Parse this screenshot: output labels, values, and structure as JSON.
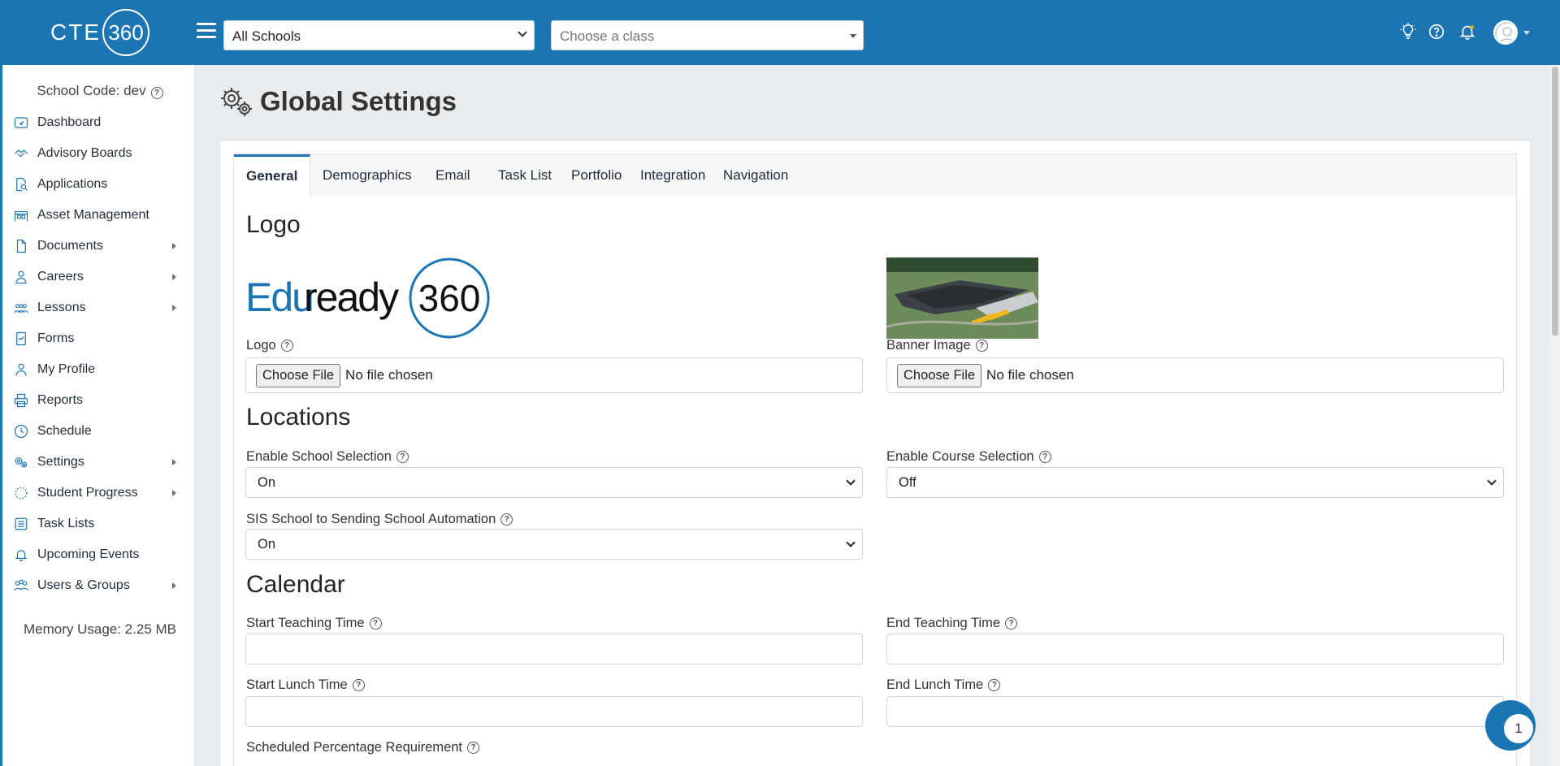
{
  "header": {
    "brand_text": "CTE",
    "brand_ring": "360",
    "school_select": "All Schools",
    "class_select_placeholder": "Choose a class",
    "icons": [
      "lightbulb-icon",
      "help-icon",
      "bell-icon",
      "user-avatar"
    ]
  },
  "sidebar": {
    "school_code": "School Code: dev",
    "items": [
      {
        "label": "Dashboard",
        "icon": "dashboard-icon",
        "has_submenu": false
      },
      {
        "label": "Advisory Boards",
        "icon": "handshake-icon",
        "has_submenu": false
      },
      {
        "label": "Applications",
        "icon": "document-search-icon",
        "has_submenu": false
      },
      {
        "label": "Asset Management",
        "icon": "warehouse-icon",
        "has_submenu": false
      },
      {
        "label": "Documents",
        "icon": "file-icon",
        "has_submenu": true
      },
      {
        "label": "Careers",
        "icon": "careers-icon",
        "has_submenu": true
      },
      {
        "label": "Lessons",
        "icon": "people-icon",
        "has_submenu": true
      },
      {
        "label": "Forms",
        "icon": "form-icon",
        "has_submenu": false
      },
      {
        "label": "My Profile",
        "icon": "user-icon",
        "has_submenu": false
      },
      {
        "label": "Reports",
        "icon": "printer-icon",
        "has_submenu": false
      },
      {
        "label": "Schedule",
        "icon": "clock-icon",
        "has_submenu": false
      },
      {
        "label": "Settings",
        "icon": "gears-icon",
        "has_submenu": true
      },
      {
        "label": "Student Progress",
        "icon": "progress-icon",
        "has_submenu": true
      },
      {
        "label": "Task Lists",
        "icon": "list-icon",
        "has_submenu": false
      },
      {
        "label": "Upcoming Events",
        "icon": "bell-icon",
        "has_submenu": false
      },
      {
        "label": "Users & Groups",
        "icon": "users-icon",
        "has_submenu": true
      }
    ],
    "memory_usage": "Memory Usage: 2.25 MB"
  },
  "main": {
    "title": "Global Settings",
    "tabs": [
      {
        "label": "General",
        "active": true
      },
      {
        "label": "Demographics",
        "active": false
      },
      {
        "label": "Email",
        "active": false
      },
      {
        "label": "Task List",
        "active": false
      },
      {
        "label": "Portfolio",
        "active": false
      },
      {
        "label": "Integration",
        "active": false
      },
      {
        "label": "Navigation",
        "active": false
      }
    ],
    "logo_section": {
      "heading": "Logo",
      "logo_image_text": "Eduready",
      "logo_image_ring": "360",
      "logo_label": "Logo",
      "banner_label": "Banner Image",
      "choose_file": "Choose File",
      "no_file": "No file chosen"
    },
    "locations_section": {
      "heading": "Locations",
      "school_selection_label": "Enable School Selection",
      "school_selection_value": "On",
      "course_selection_label": "Enable Course Selection",
      "course_selection_value": "Off",
      "sis_label": "SIS School to Sending School Automation",
      "sis_value": "On"
    },
    "calendar_section": {
      "heading": "Calendar",
      "start_teaching_label": "Start Teaching Time",
      "end_teaching_label": "End Teaching Time",
      "start_lunch_label": "Start Lunch Time",
      "end_lunch_label": "End Lunch Time",
      "scheduled_pct_label": "Scheduled Percentage Requirement",
      "start_teaching_value": "",
      "end_teaching_value": "",
      "start_lunch_value": "",
      "end_lunch_value": ""
    }
  },
  "chat": {
    "count": "1"
  },
  "colors": {
    "brand": "#1b75b3",
    "background": "#e9ecef"
  }
}
